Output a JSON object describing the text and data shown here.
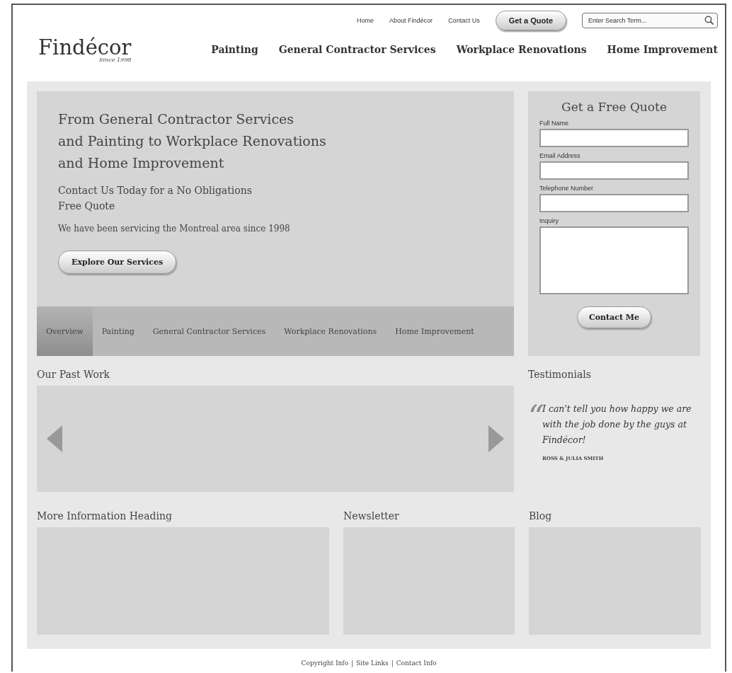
{
  "header": {
    "logo": "Findécor",
    "tagline": "Since 1998",
    "top_links": [
      "Home",
      "About Findécor",
      "Contact Us"
    ],
    "quote_button": "Get a Quote",
    "search": {
      "placeholder": "Enter Search Term..."
    },
    "main_nav": [
      "Painting",
      "General Contractor Services",
      "Workplace Renovations",
      "Home Improvement"
    ]
  },
  "hero": {
    "headline": [
      "From General Contractor Services",
      "and Painting to Workplace Renovations",
      "and Home Improvement"
    ],
    "subheadline": [
      "Contact Us Today for a No Obligations",
      "Free Quote"
    ],
    "note": "We have been servicing the Montreal area since 1998",
    "button": "Explore Our Services",
    "tabs": [
      {
        "label": "Overview",
        "selected": true
      },
      {
        "label": "Painting",
        "selected": false
      },
      {
        "label": "General Contractor Services",
        "selected": false
      },
      {
        "label": "Workplace Renovations",
        "selected": false
      },
      {
        "label": "Home Improvement",
        "selected": false
      }
    ]
  },
  "quote_form": {
    "title": "Get a Free Quote",
    "fields": [
      {
        "label": "Full Name",
        "kind": "input"
      },
      {
        "label": "Email Address",
        "kind": "input"
      },
      {
        "label": "Telephone Number",
        "kind": "input"
      },
      {
        "label": "Inquiry",
        "kind": "textarea"
      }
    ],
    "button": "Contact Me"
  },
  "past_work": {
    "heading": "Our Past Work"
  },
  "testimonials": {
    "heading": "Testimonials",
    "quote_mark": "“",
    "quote": "I can't tell you how happy we are with the job done by the guys at Findécor!",
    "author": "ROSS & JULIA SMITH"
  },
  "bottom_sections": [
    {
      "heading": "More Information Heading"
    },
    {
      "heading": "Newsletter"
    },
    {
      "heading": "Blog"
    }
  ],
  "footer": {
    "links": [
      "Copyright Info",
      "Site Links",
      "Contact Info"
    ],
    "separator": "|"
  }
}
